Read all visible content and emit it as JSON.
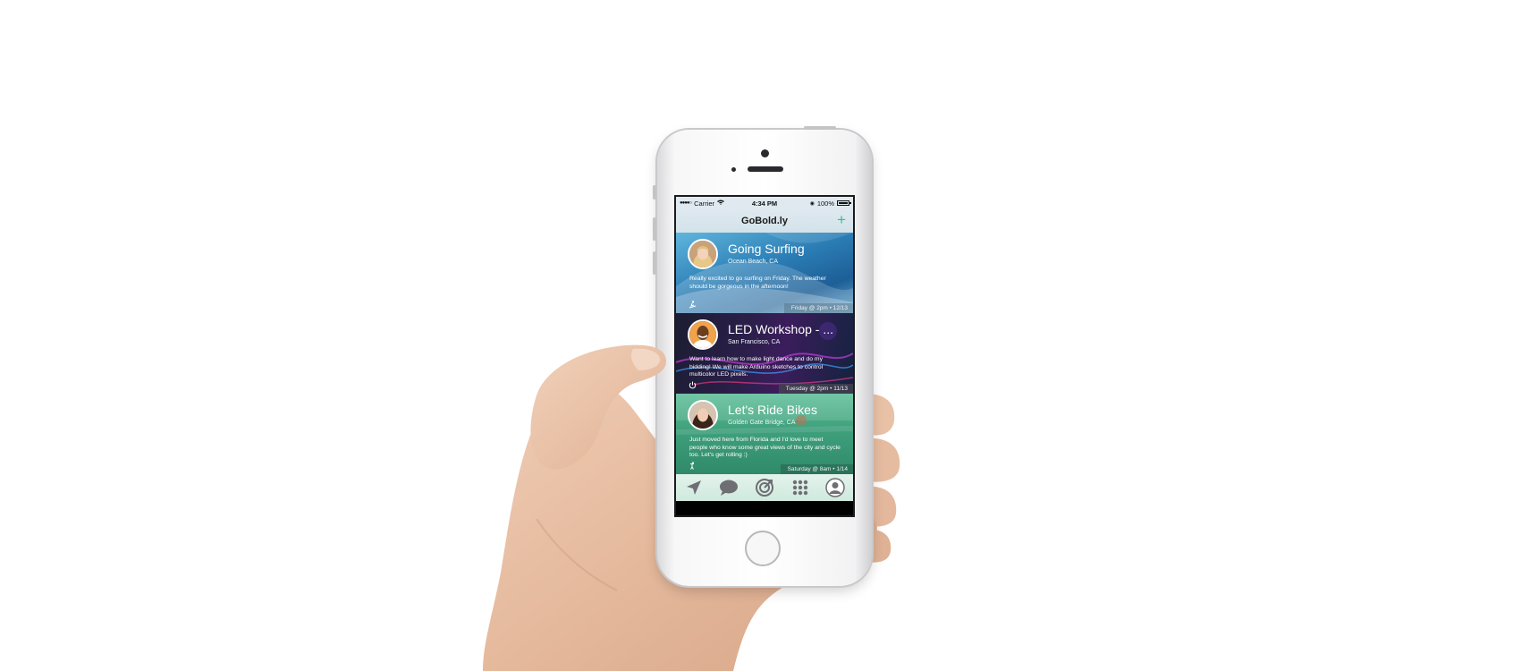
{
  "status_bar": {
    "signal": "●●●●○",
    "carrier": "Carrier",
    "time": "4:34 PM",
    "battery": "100%"
  },
  "nav": {
    "title": "GoBold.ly",
    "add_label": "+"
  },
  "accent_color": "#2ec28a",
  "feed": [
    {
      "title": "Going Surfing",
      "location": "Ocean Beach, CA",
      "description": "Really excited to go surfing on Friday. The weather should be gorgeous in the afternoon!",
      "when": "Friday @ 2pm  •  12/13",
      "category_icon": "surfer-icon"
    },
    {
      "title": "LED Workshop - ...",
      "location": "San Francisco, CA",
      "description": "Want to learn how to make light dance and do my bidding! We will make Arduino sketches to control multicolor LED pixels.",
      "when": "Tuesday @ 2pm  •  11/13",
      "category_icon": "power-icon"
    },
    {
      "title": "Let's Ride Bikes",
      "location": "Golden Gate Bridge, CA",
      "description": "Just moved here from Florida and I'd love to meet people who know some great views of the city and cycle too. Let's get rolling :)",
      "when": "Saturday @ 8am  •  1/14",
      "category_icon": "cyclist-icon"
    }
  ],
  "tabs": [
    {
      "icon": "location-arrow-icon"
    },
    {
      "icon": "chat-bubble-icon"
    },
    {
      "icon": "radar-icon"
    },
    {
      "icon": "grid-icon"
    },
    {
      "icon": "profile-icon"
    }
  ]
}
